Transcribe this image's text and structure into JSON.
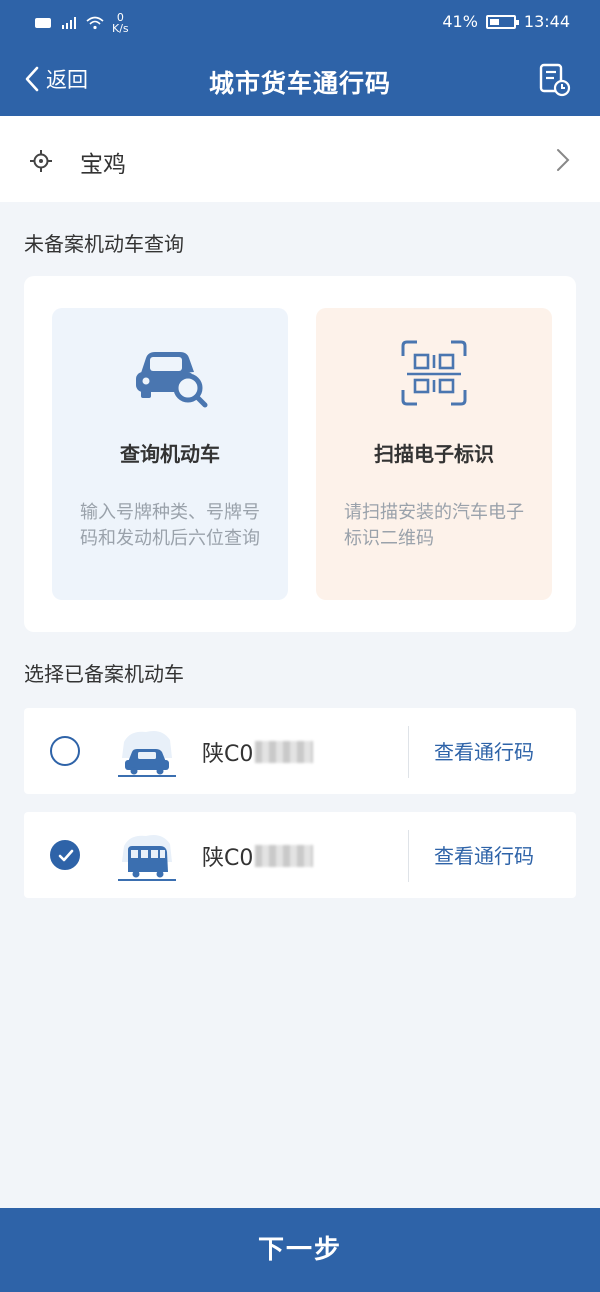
{
  "status_bar": {
    "net_speed_value": "0",
    "net_speed_unit": "K/s",
    "battery": "41%",
    "battery_level": 0.41,
    "time": "13:44"
  },
  "nav": {
    "back_label": "返回",
    "title": "城市货车通行码"
  },
  "city": {
    "name": "宝鸡"
  },
  "unregistered_section": {
    "label": "未备案机动车查询",
    "options": [
      {
        "title": "查询机动车",
        "desc": "输入号牌种类、号牌号码和发动机后六位查询",
        "icon": "car-search-icon"
      },
      {
        "title": "扫描电子标识",
        "desc": "请扫描安装的汽车电子标识二维码",
        "icon": "qr-scan-icon"
      }
    ]
  },
  "registered_section": {
    "label": "选择已备案机动车",
    "vehicles": [
      {
        "plate": "陕C0",
        "checked": false,
        "icon": "sedan-icon",
        "action": "查看通行码"
      },
      {
        "plate": "陕C0",
        "checked": true,
        "icon": "van-icon",
        "action": "查看通行码"
      }
    ]
  },
  "footer": {
    "next_label": "下一步"
  },
  "colors": {
    "primary": "#2e63a8",
    "card_blue": "#eef4fb",
    "card_orange": "#fdf2ea",
    "background": "#f2f5f9"
  }
}
